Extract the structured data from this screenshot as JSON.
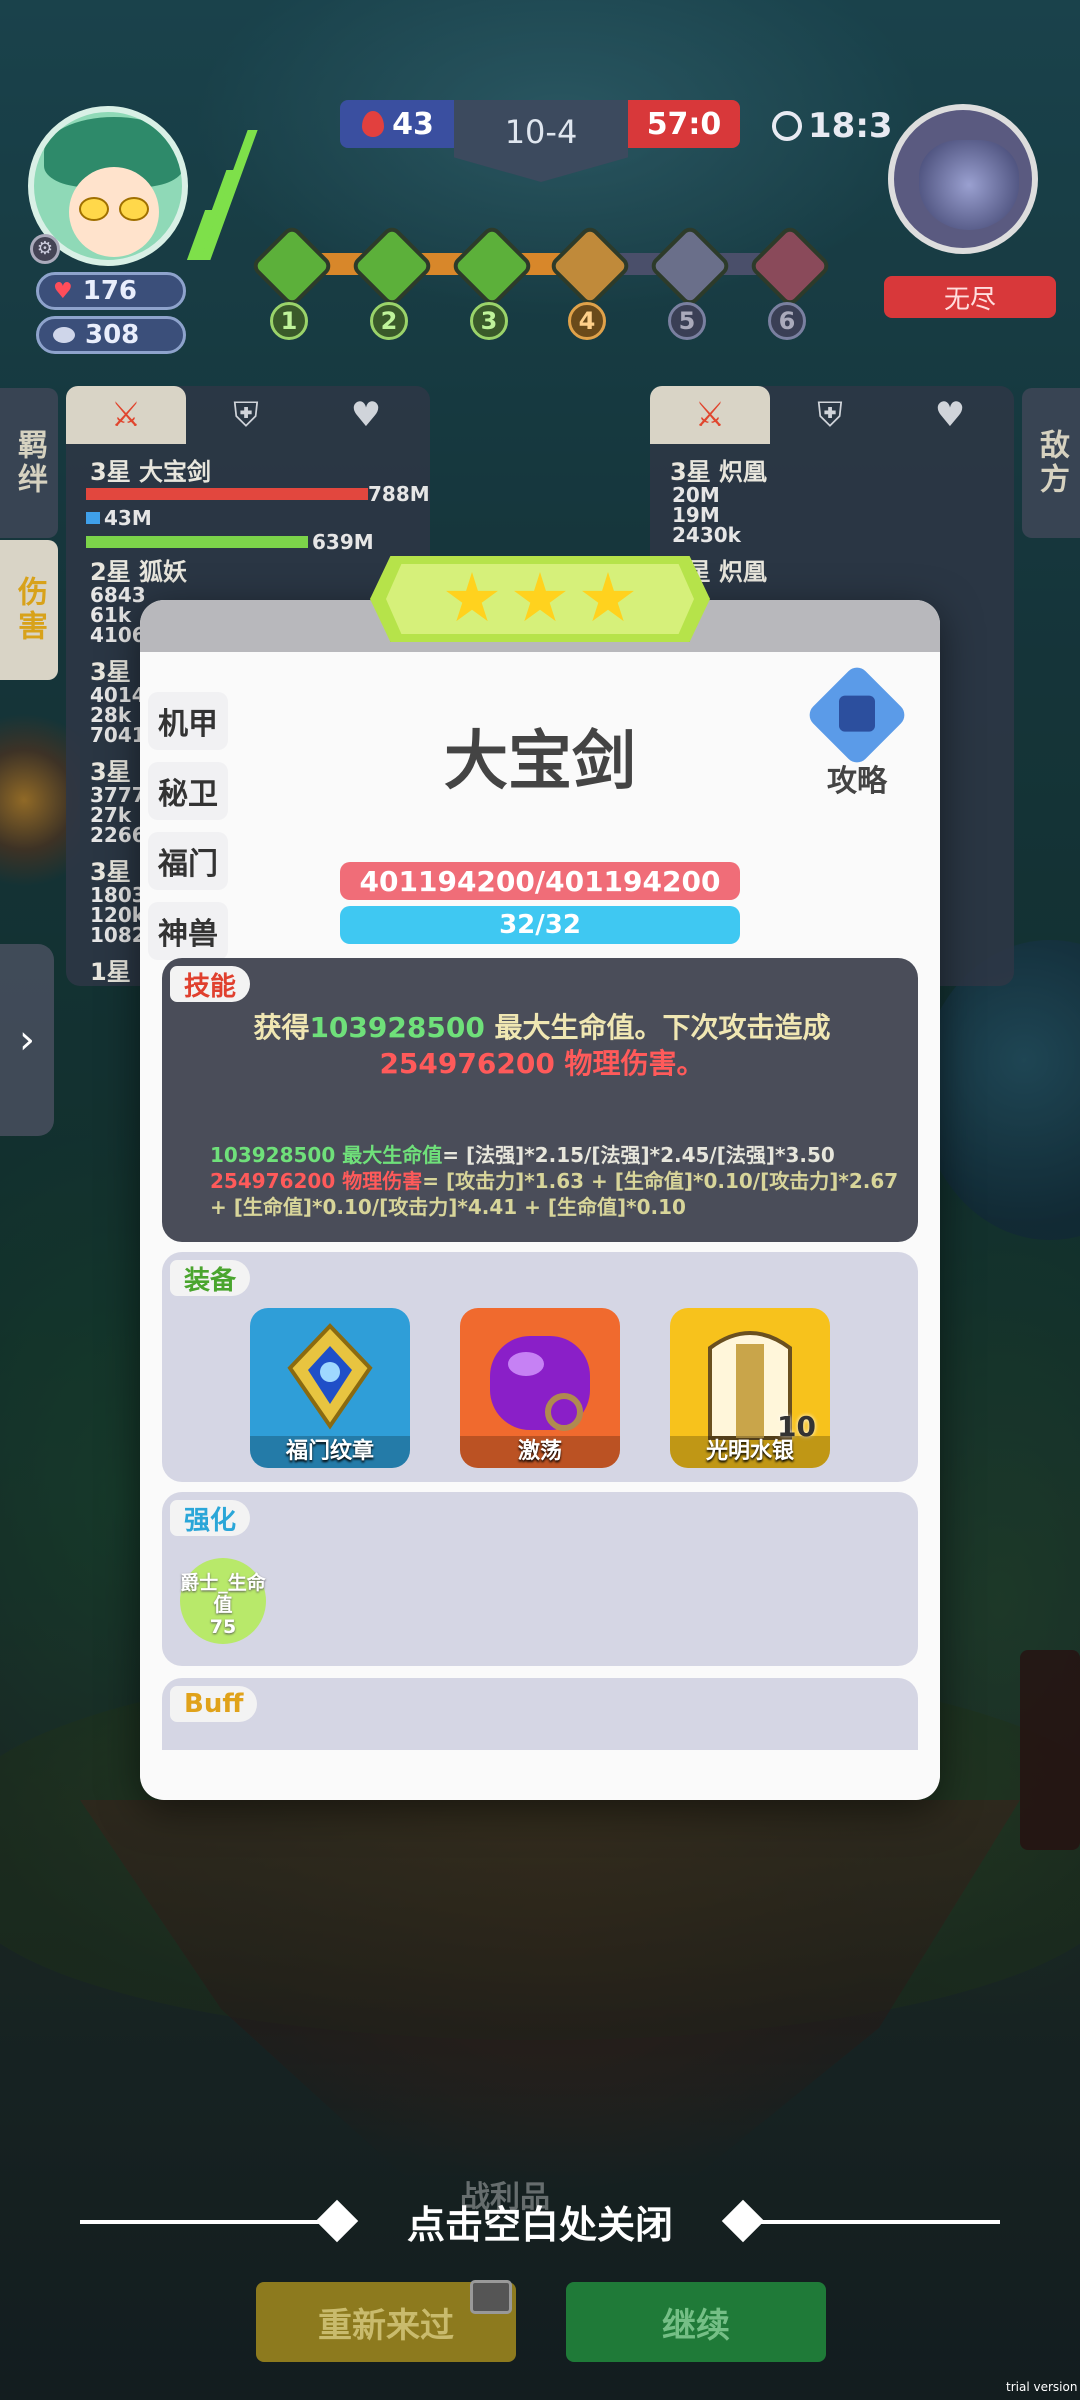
{
  "hud": {
    "player_hp": "176",
    "player_gold": "308",
    "score_left": "43",
    "round": "10-4",
    "score_right": "57:0",
    "timer": "18:3",
    "enemy_label": "无尽",
    "stages": [
      "1",
      "2",
      "3",
      "4",
      "5",
      "6"
    ]
  },
  "left_side_tabs": {
    "bond": "羁绊",
    "damage": "伤害"
  },
  "right_side_tabs": {
    "enemy": "敌方"
  },
  "left_panel": {
    "units": [
      {
        "name": "3星 大宝剑",
        "v1": "788M",
        "v2": "43M",
        "v3": "639M"
      },
      {
        "name": "2星 狐妖",
        "nums": [
          "6843",
          "61k",
          "4106"
        ]
      },
      {
        "name": "3星",
        "nums": [
          "4014",
          "28k",
          "7041"
        ]
      },
      {
        "name": "3星",
        "nums": [
          "3777",
          "27k",
          "2266"
        ]
      },
      {
        "name": "3星",
        "nums": [
          "1803",
          "120k",
          "1082"
        ]
      },
      {
        "name": "1星",
        "nums": []
      }
    ]
  },
  "right_panel": {
    "units": [
      {
        "name": "3星 炽凰",
        "nums": [
          "20M",
          "19M",
          "2430k"
        ]
      },
      {
        "name": "3星 炽凰",
        "nums": []
      }
    ]
  },
  "modal": {
    "category_tabs": [
      "机甲",
      "秘卫",
      "福门",
      "神兽"
    ],
    "hero_name": "大宝剑",
    "guide_label": "攻略",
    "hp_text": "401194200/401194200",
    "mp_text": "32/32",
    "skill": {
      "tag": "技能",
      "line_a": "获得",
      "hp_value": "103928500",
      "line_b": " 最大生命值。下次攻击造成",
      "dmg_value": "254976200",
      "line_c": " 物理伤害。",
      "formula1_green": "103928500 最大生命值",
      "formula1_rest": "= [法强]*2.15/[法强]*2.45/[法强]*3.50",
      "formula2_red": "254976200 物理伤害",
      "formula2_rest": "= [攻击力]*1.63 + [生命值]*0.10/[攻击力]*2.67 + [生命值]*0.10/[攻击力]*4.41 + [生命值]*0.10"
    },
    "equipment": {
      "tag": "装备",
      "items": [
        {
          "label": "福门纹章",
          "icon": "emblem-icon",
          "color": "#2f9ed8",
          "count": ""
        },
        {
          "label": "激荡",
          "icon": "purple-orb-icon",
          "color": "#f06a2e",
          "count": ""
        },
        {
          "label": "光明水银",
          "icon": "armor-icon",
          "color": "#f7c21c",
          "count": "10"
        }
      ]
    },
    "enhance": {
      "tag": "强化",
      "badge_label": "爵士_生命值",
      "badge_value": "75"
    },
    "buff": {
      "tag": "Buff"
    }
  },
  "bottom": {
    "close_hint": "点击空白处关闭",
    "loot_label": "战利品",
    "retry_button": "重新来过",
    "continue_button": "继续",
    "watermark": "trial version"
  },
  "colors": {
    "hp_bar": "#f06d78",
    "mp_bar": "#3fc8f2",
    "skill_bg": "#4a4d59",
    "section_bg": "#d5d6e4"
  }
}
